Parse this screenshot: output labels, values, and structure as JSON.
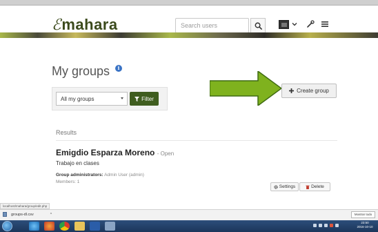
{
  "header": {
    "logo_mark": "ℰ",
    "logo_text": "mahara",
    "search_placeholder": "Search users"
  },
  "page": {
    "title": "My groups",
    "filter": {
      "selected": "All my groups",
      "button_label": "Filter"
    },
    "create_button_label": "Create group",
    "results_label": "Results",
    "group": {
      "name": "Emigdio Esparza Moreno",
      "status": "- Open",
      "description": "Trabajo en clases",
      "admins_label": "Group administrators:",
      "admins_value": "Admin User (admin)",
      "members": "Members: 1",
      "settings_label": "Settings",
      "delete_label": "Delete"
    }
  },
  "browser": {
    "status_url": "localhost/mahara/group/edit.php",
    "download_item": "groups-dl.csv",
    "show_all_label": "Mostrar todo"
  },
  "taskbar": {
    "time": "23:50",
    "date": "2016-10-10"
  },
  "colors": {
    "brand_green": "#3f5d1f",
    "arrow_green": "#7fb21e",
    "info_blue": "#3a73c5",
    "delete_red": "#c0392b"
  }
}
